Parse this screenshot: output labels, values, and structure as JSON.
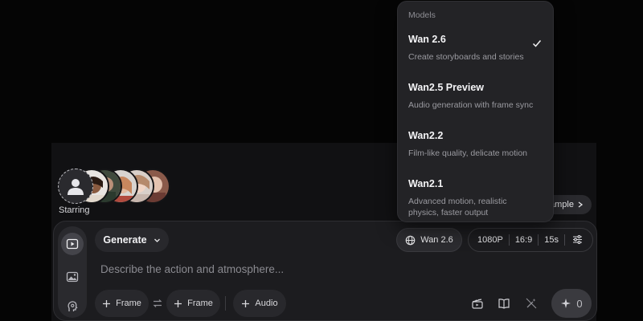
{
  "starring": {
    "label": "Starring",
    "cast_count": 5
  },
  "example_pill": {
    "label": "ample"
  },
  "composer": {
    "mode_rail": [
      "video-mode",
      "image-mode",
      "avatar-mode"
    ],
    "generate_label": "Generate",
    "model_label": "Wan 2.6",
    "settings": {
      "resolution": "1080P",
      "aspect": "16:9",
      "duration": "15s"
    },
    "prompt_placeholder": "Describe the action and atmosphere...",
    "frame_start_label": "Frame",
    "frame_end_label": "Frame",
    "audio_label": "Audio",
    "credits": "0"
  },
  "model_menu": {
    "heading": "Models",
    "items": [
      {
        "name": "Wan 2.6",
        "desc": "Create storyboards and stories",
        "selected": true
      },
      {
        "name": "Wan2.5 Preview",
        "desc": "Audio generation with frame sync",
        "selected": false
      },
      {
        "name": "Wan2.2",
        "desc": "Film-like quality, delicate motion",
        "selected": false
      },
      {
        "name": "Wan2.1",
        "desc": "Advanced motion, realistic physics, faster output",
        "selected": false
      }
    ]
  },
  "colors": {
    "menu_bg": "#232326",
    "composer_bg": "#1c1c1f",
    "page_bg": "#050505"
  }
}
